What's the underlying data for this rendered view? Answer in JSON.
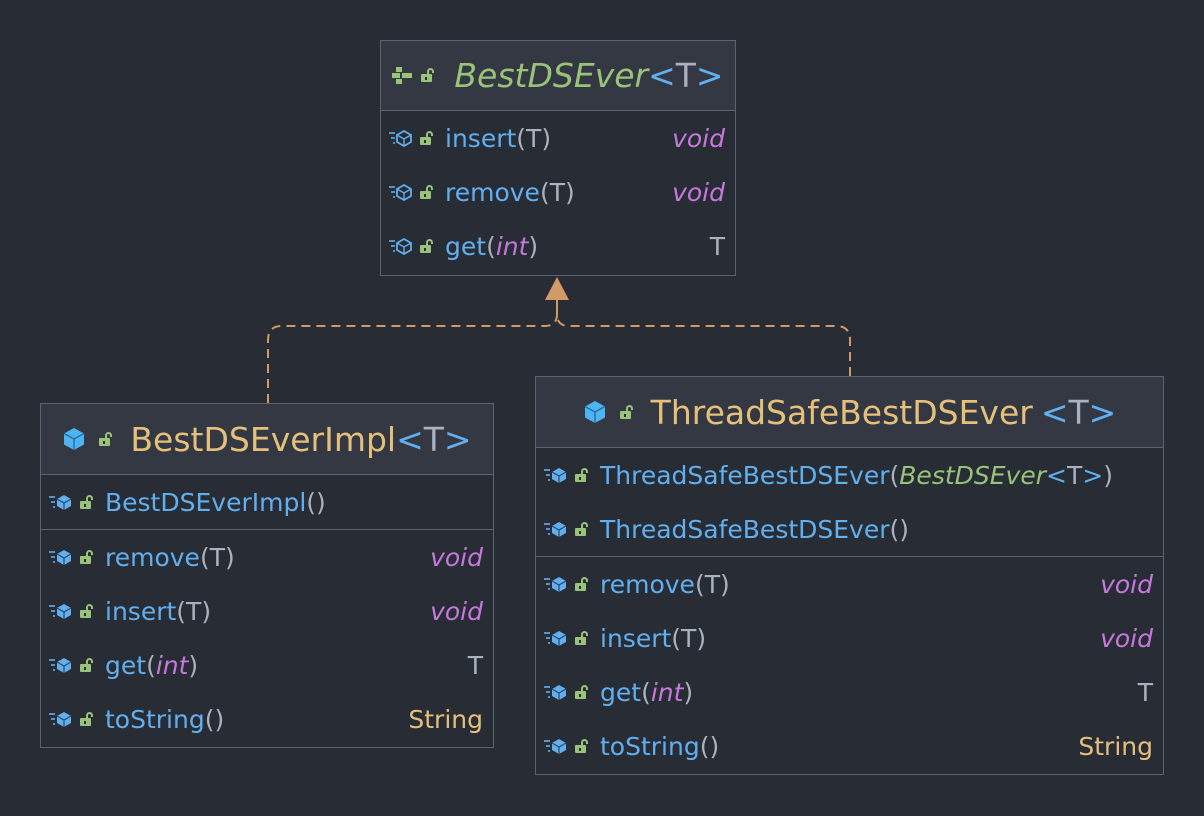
{
  "interface_box": {
    "name": "BestDSEver",
    "generic_open": "<",
    "generic_param": "T",
    "generic_close": ">",
    "methods": [
      {
        "name": "insert",
        "open": "(",
        "param": "T",
        "close": ")",
        "ret": "void"
      },
      {
        "name": "remove",
        "open": "(",
        "param": "T",
        "close": ")",
        "ret": "void"
      },
      {
        "name": "get",
        "open": "(",
        "param": "int",
        "close": ")",
        "ret": "T"
      }
    ]
  },
  "impl_box": {
    "name": "BestDSEverImpl",
    "generic_open": "<",
    "generic_param": "T",
    "generic_close": ">",
    "constructor": {
      "name": "BestDSEverImpl",
      "parens": "()"
    },
    "methods": [
      {
        "name": "remove",
        "open": "(",
        "param": "T",
        "close": ")",
        "ret": "void"
      },
      {
        "name": "insert",
        "open": "(",
        "param": "T",
        "close": ")",
        "ret": "void"
      },
      {
        "name": "get",
        "open": "(",
        "param": "int",
        "close": ")",
        "ret": "T"
      },
      {
        "name": "toString",
        "parens": "()",
        "ret": "String"
      }
    ]
  },
  "threadsafe_box": {
    "name": "ThreadSafeBestDSEver",
    "generic_open": "<",
    "generic_param": "T",
    "generic_close": ">",
    "constructors": [
      {
        "name": "ThreadSafeBestDSEver",
        "open": "(",
        "param_type": "BestDSEver",
        "param_generic_open": "<",
        "param_generic": "T",
        "param_generic_close": ">",
        "close": ")"
      },
      {
        "name": "ThreadSafeBestDSEver",
        "parens": "()"
      }
    ],
    "methods": [
      {
        "name": "remove",
        "open": "(",
        "param": "T",
        "close": ")",
        "ret": "void"
      },
      {
        "name": "insert",
        "open": "(",
        "param": "T",
        "close": ")",
        "ret": "void"
      },
      {
        "name": "get",
        "open": "(",
        "param": "int",
        "close": ")",
        "ret": "T"
      },
      {
        "name": "toString",
        "parens": "()",
        "ret": "String"
      }
    ]
  },
  "colors": {
    "background": "#282c34",
    "header": "#343843",
    "border": "#5c6370",
    "arrow": "#d19a66",
    "method": "#61afef",
    "keyword": "#c678dd",
    "class_name": "#e5c07b",
    "interface_name": "#98c379"
  },
  "icons": {
    "interface": "interface-icon",
    "class": "class-icon",
    "method_abstract": "abstract-method-icon",
    "method": "method-icon",
    "visibility": "public-lock-icon"
  }
}
